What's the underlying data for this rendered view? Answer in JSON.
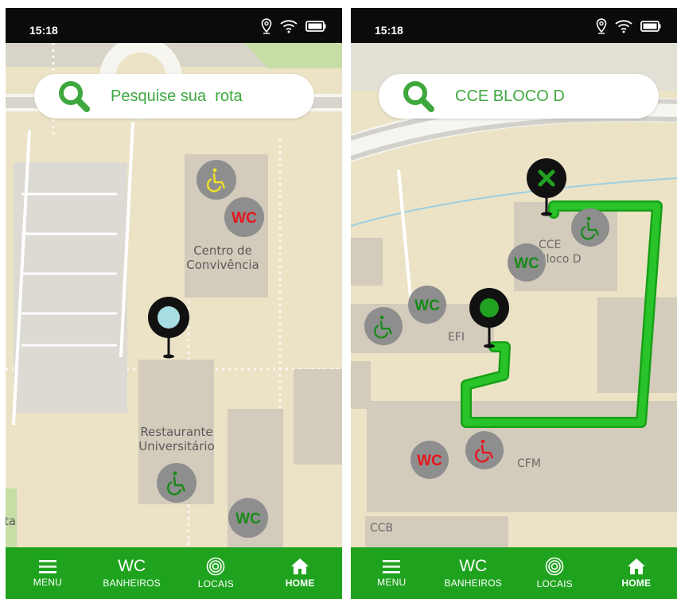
{
  "screens": [
    {
      "status": {
        "time": "15:18"
      },
      "search": {
        "placeholder": "Pesquise sua  rota",
        "value": ""
      },
      "map": {
        "labels": {
          "centro": [
            "Centro de",
            "Convivência"
          ],
          "restaurante": [
            "Restaurante",
            "Universitário"
          ],
          "edge": "ta"
        },
        "markers": [
          "accessible-marker",
          "wc-marker-red",
          "accessible-marker-green",
          "wc-marker-green",
          "location-pin"
        ]
      },
      "nav": {
        "menu": "MENU",
        "wc": "WC",
        "banheiros": "BANHEIROS",
        "locais": "LOCAIS",
        "home": "HOME"
      }
    },
    {
      "status": {
        "time": "15:18"
      },
      "search": {
        "placeholder": "",
        "value": "CCE BLOCO D"
      },
      "map": {
        "labels": {
          "cce": [
            "CCE",
            "Bloco D"
          ],
          "efi": "EFI",
          "cfm": "CFM",
          "ccb": "CCB"
        },
        "route_color": "#1bb51b"
      },
      "nav": {
        "menu": "MENU",
        "wc": "WC",
        "banheiros": "BANHEIROS",
        "locais": "LOCAIS",
        "home": "HOME"
      }
    }
  ],
  "colors": {
    "accent": "#1fa31f",
    "search_text": "#3ea83e",
    "wc_red": "#e8141c",
    "wc_green": "#188a18"
  }
}
